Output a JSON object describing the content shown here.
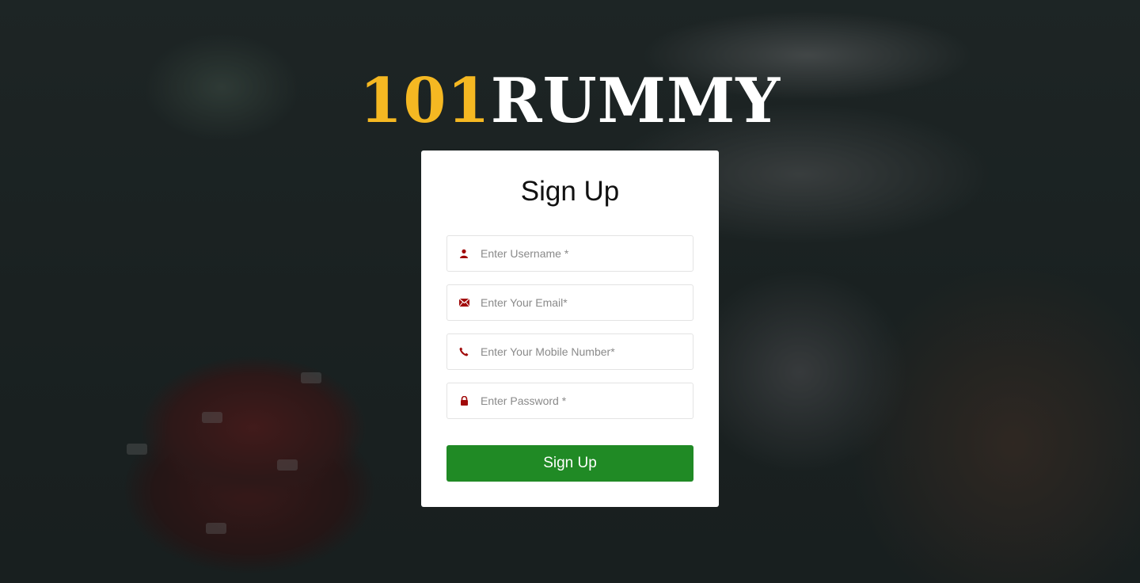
{
  "logo": {
    "number": "101",
    "word": "RUMMY"
  },
  "form": {
    "title": "Sign Up",
    "fields": [
      {
        "name": "username",
        "placeholder": "Enter Username *",
        "icon": "user-icon"
      },
      {
        "name": "email",
        "placeholder": "Enter Your Email*",
        "icon": "envelope-icon"
      },
      {
        "name": "mobile",
        "placeholder": "Enter Your Mobile Number*",
        "icon": "phone-icon"
      },
      {
        "name": "password",
        "placeholder": "Enter Password *",
        "icon": "lock-icon"
      }
    ],
    "submit_label": "Sign Up"
  },
  "colors": {
    "brand_gold": "#f5b822",
    "button_green": "#208a25",
    "icon_red": "#a10a0a"
  }
}
